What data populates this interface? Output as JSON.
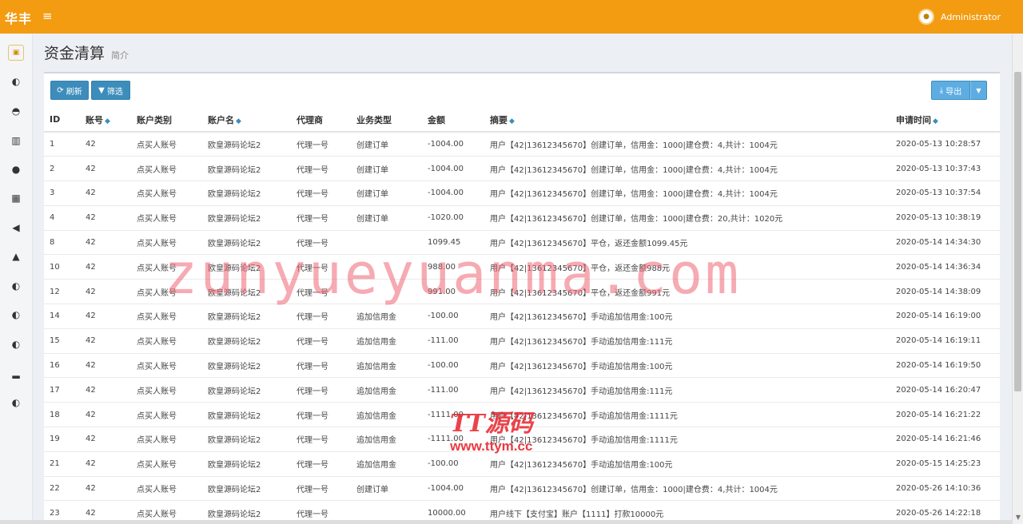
{
  "header": {
    "brand": "华丰",
    "menu_icon": "≡",
    "user_name": "Administrator"
  },
  "sidebar": {
    "icons": [
      "logo",
      "circle-half-icon",
      "tachometer-icon",
      "bar-chart-icon",
      "users-icon",
      "bank-icon",
      "bullhorn-icon",
      "lock-icon",
      "circle-half-icon",
      "circle-half-icon",
      "circle-half-icon",
      "signal-icon",
      "circle-half-icon"
    ]
  },
  "page": {
    "title": "资金清算",
    "subtitle": "简介"
  },
  "toolbar": {
    "refresh_label": "刷新",
    "filter_label": "筛选",
    "export_label": "导出"
  },
  "table": {
    "columns": [
      "ID",
      "账号",
      "账户类别",
      "账户名",
      "代理商",
      "业务类型",
      "金额",
      "摘要",
      "申请时间"
    ],
    "rows": [
      [
        "1",
        "42",
        "点买人账号",
        "欧皇源码论坛2",
        "代理一号",
        "创建订单",
        "-1004.00",
        "用户【42|13612345670】创建订单，信用金：1000|建仓费：4,共计：1004元",
        "2020-05-13 10:28:57"
      ],
      [
        "2",
        "42",
        "点买人账号",
        "欧皇源码论坛2",
        "代理一号",
        "创建订单",
        "-1004.00",
        "用户【42|13612345670】创建订单，信用金：1000|建仓费：4,共计：1004元",
        "2020-05-13 10:37:43"
      ],
      [
        "3",
        "42",
        "点买人账号",
        "欧皇源码论坛2",
        "代理一号",
        "创建订单",
        "-1004.00",
        "用户【42|13612345670】创建订单，信用金：1000|建仓费：4,共计：1004元",
        "2020-05-13 10:37:54"
      ],
      [
        "4",
        "42",
        "点买人账号",
        "欧皇源码论坛2",
        "代理一号",
        "创建订单",
        "-1020.00",
        "用户【42|13612345670】创建订单，信用金：1000|建仓费：20,共计：1020元",
        "2020-05-13 10:38:19"
      ],
      [
        "8",
        "42",
        "点买人账号",
        "欧皇源码论坛2",
        "代理一号",
        "",
        "1099.45",
        "用户【42|13612345670】平仓，返还金额1099.45元",
        "2020-05-14 14:34:30"
      ],
      [
        "10",
        "42",
        "点买人账号",
        "欧皇源码论坛2",
        "代理一号",
        "",
        "988.00",
        "用户【42|13612345670】平仓，返还金额988元",
        "2020-05-14 14:36:34"
      ],
      [
        "12",
        "42",
        "点买人账号",
        "欧皇源码论坛2",
        "代理一号",
        "",
        "991.00",
        "用户【42|13612345670】平仓，返还金额991元",
        "2020-05-14 14:38:09"
      ],
      [
        "14",
        "42",
        "点买人账号",
        "欧皇源码论坛2",
        "代理一号",
        "追加信用金",
        "-100.00",
        "用户【42|13612345670】手动追加信用金:100元",
        "2020-05-14 16:19:00"
      ],
      [
        "15",
        "42",
        "点买人账号",
        "欧皇源码论坛2",
        "代理一号",
        "追加信用金",
        "-111.00",
        "用户【42|13612345670】手动追加信用金:111元",
        "2020-05-14 16:19:11"
      ],
      [
        "16",
        "42",
        "点买人账号",
        "欧皇源码论坛2",
        "代理一号",
        "追加信用金",
        "-100.00",
        "用户【42|13612345670】手动追加信用金:100元",
        "2020-05-14 16:19:50"
      ],
      [
        "17",
        "42",
        "点买人账号",
        "欧皇源码论坛2",
        "代理一号",
        "追加信用金",
        "-111.00",
        "用户【42|13612345670】手动追加信用金:111元",
        "2020-05-14 16:20:47"
      ],
      [
        "18",
        "42",
        "点买人账号",
        "欧皇源码论坛2",
        "代理一号",
        "追加信用金",
        "-1111.00",
        "用户【42|13612345670】手动追加信用金:1111元",
        "2020-05-14 16:21:22"
      ],
      [
        "19",
        "42",
        "点买人账号",
        "欧皇源码论坛2",
        "代理一号",
        "追加信用金",
        "-1111.00",
        "用户【42|13612345670】手动追加信用金:1111元",
        "2020-05-14 16:21:46"
      ],
      [
        "21",
        "42",
        "点买人账号",
        "欧皇源码论坛2",
        "代理一号",
        "追加信用金",
        "-100.00",
        "用户【42|13612345670】手动追加信用金:100元",
        "2020-05-15 14:25:23"
      ],
      [
        "22",
        "42",
        "点买人账号",
        "欧皇源码论坛2",
        "代理一号",
        "创建订单",
        "-1004.00",
        "用户【42|13612345670】创建订单，信用金：1000|建仓费：4,共计：1004元",
        "2020-05-26 14:10:36"
      ],
      [
        "23",
        "42",
        "点买人账号",
        "欧皇源码论坛2",
        "代理一号",
        "",
        "10000.00",
        "用户线下【支付宝】账户【1111】打款10000元",
        "2020-05-26 14:22:18"
      ]
    ]
  },
  "watermarks": {
    "main": "zunyueyuanma.com",
    "logo_text": "TT源码",
    "logo_url": "www.ttym.cc"
  },
  "colors": {
    "topbar": "#f39c12",
    "primary_button": "#3c8dbc",
    "export_button": "#5dade2",
    "watermark": "#ee6473"
  }
}
